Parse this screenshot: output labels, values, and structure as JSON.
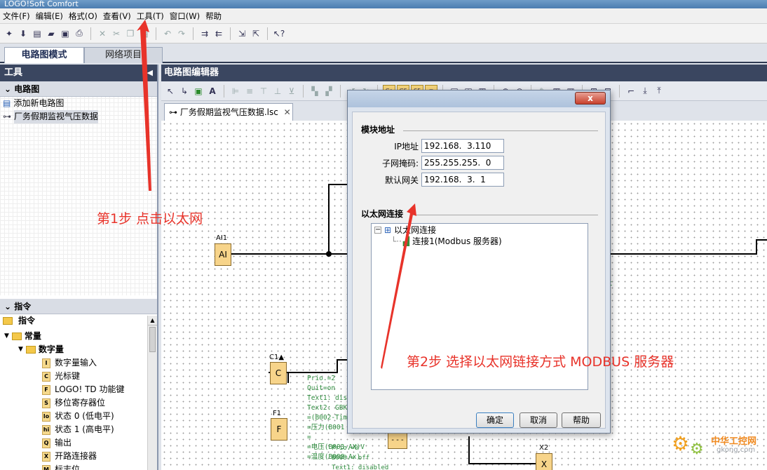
{
  "window": {
    "title": "LOGO!Soft Comfort"
  },
  "menu": [
    "文件(F)",
    "编辑(E)",
    "格式(O)",
    "查看(V)",
    "工具(T)",
    "窗口(W)",
    "帮助"
  ],
  "mode_tabs": {
    "active": "电路图模式",
    "inactive": "网络项目"
  },
  "tools_panel": {
    "title": "工具",
    "section": "电路图",
    "items": [
      "添加新电路图",
      "厂务假期监视气压数据"
    ]
  },
  "instructions_panel": {
    "section": "指令",
    "root": "指令",
    "group1": "常量",
    "group2": "数字量",
    "items": [
      {
        "chip": "I",
        "label": "数字量输入"
      },
      {
        "chip": "C",
        "label": "光标键"
      },
      {
        "chip": "F",
        "label": "LOGO! TD 功能键"
      },
      {
        "chip": "S",
        "label": "移位寄存器位"
      },
      {
        "chip": "lo",
        "label": "状态 0 (低电平)"
      },
      {
        "chip": "hi",
        "label": "状态 1 (高电平)"
      },
      {
        "chip": "Q",
        "label": "输出"
      },
      {
        "chip": "X",
        "label": "开路连接器"
      },
      {
        "chip": "M",
        "label": "标志位"
      }
    ]
  },
  "editor": {
    "title": "电路图编辑器",
    "doc_tab": "厂务假期监视气压数据.lsc",
    "blocks": {
      "ai": {
        "name": "AI1",
        "text": "AI"
      },
      "c": {
        "name": "C1▲",
        "text": "C"
      },
      "f": {
        "name": "F1",
        "text": "F"
      },
      "x": {
        "name": "X2",
        "text": "X"
      },
      "dash": "- - -"
    },
    "canvas_text": "Prio.=2\nQuit=on\nText1: disab\nText2: GBK\n=(B002-Tim\n=压力(B001\n=\n=电压(B003-AX)V\n=温度(B008-Ax)",
    "canvas_text2": "Prio.=0\nB008.= off\nText1: disabled",
    "fragment": "t"
  },
  "dialog": {
    "close": "x",
    "module_section": "模块地址",
    "fields": [
      {
        "label": "IP地址",
        "value": "192.168.  3.110"
      },
      {
        "label": "子网掩码:",
        "value": "255.255.255.  0"
      },
      {
        "label": "默认网关",
        "value": "192.168.  3.  1"
      }
    ],
    "eth_section": "以太网连接",
    "tree_root": "以太网连接",
    "tree_child": "连接1(Modbus 服务器)",
    "buttons": {
      "ok": "确定",
      "cancel": "取消",
      "help": "帮助"
    }
  },
  "annotations": {
    "step1": "第1步 点击以太网",
    "step2": "第2步 选择以太网链接方式 MODBUS 服务器"
  },
  "watermark": {
    "name": "中华工控网",
    "url": "gkong.com"
  },
  "colors": {
    "annotation": "#e8332a",
    "panel_header": "#3a4660",
    "block_fill": "#f7d48a"
  }
}
